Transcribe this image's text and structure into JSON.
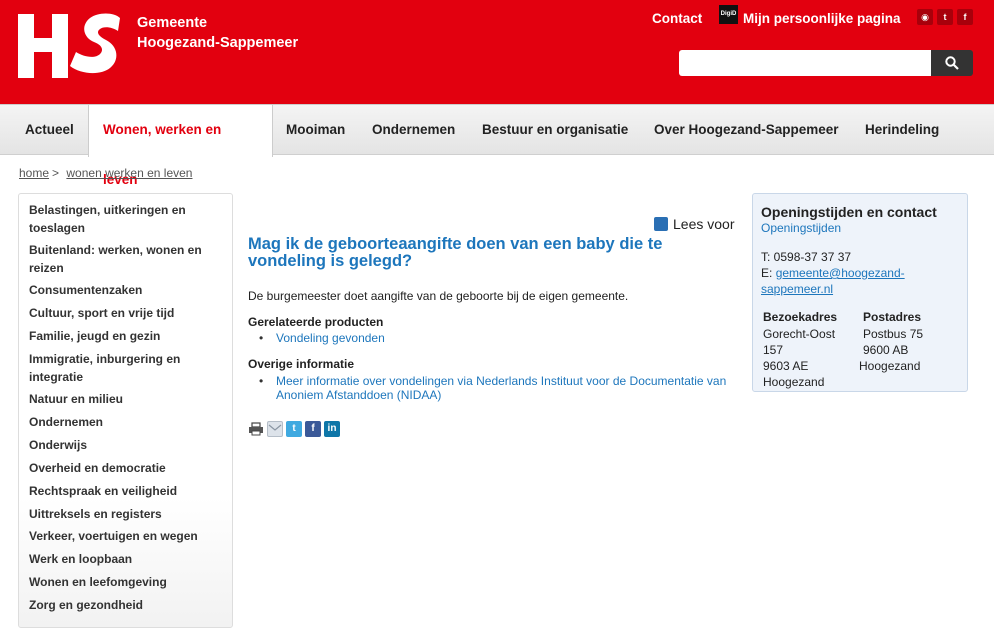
{
  "header": {
    "logo_text": "HS",
    "brand_line1": "Gemeente",
    "brand_line2": "Hoogezand-Sappemeer",
    "contact_label": "Contact",
    "digid_label": "DigiD",
    "my_page_label": "Mijn persoonlijke pagina",
    "search_placeholder": "",
    "colors": {
      "brand_red": "#e2000f",
      "link_blue": "#1d76bc"
    }
  },
  "nav": {
    "items": [
      {
        "label": "Actueel"
      },
      {
        "label": "Wonen, werken en leven"
      },
      {
        "label": "Mooiman"
      },
      {
        "label": "Ondernemen"
      },
      {
        "label": "Bestuur en organisatie"
      },
      {
        "label": "Over Hoogezand-Sappemeer"
      },
      {
        "label": "Herindeling"
      }
    ],
    "active": "Wonen, werken en leven"
  },
  "breadcrumb": {
    "home": "home",
    "separator": ">",
    "current": "wonen werken en leven"
  },
  "sidebar": {
    "items": [
      "Belastingen, uitkeringen en toeslagen",
      "Buitenland: werken, wonen en reizen",
      "Consumentenzaken",
      "Cultuur, sport en vrije tijd",
      "Familie, jeugd en gezin",
      "Immigratie, inburgering en integratie",
      "Natuur en milieu",
      "Ondernemen",
      "Onderwijs",
      "Overheid en democratie",
      "Rechtspraak en veiligheid",
      "Uittreksels en registers",
      "Verkeer, voertuigen en wegen",
      "Werk en loopbaan",
      "Wonen en leefomgeving",
      "Zorg en gezondheid"
    ]
  },
  "main": {
    "lees_voor": "Lees voor",
    "title": "Mag ik de geboorteaangifte doen van een baby die te vondeling is gelegd?",
    "lead": "De burgemeester doet aangifte van de geboorte bij de eigen gemeente.",
    "related_title": "Gerelateerde producten",
    "related_items": [
      "Vondeling gevonden"
    ],
    "other_title": "Overige informatie",
    "other_items": [
      "Meer informatie over vondelingen via Nederlands Instituut voor de Documentatie van Anoniem Afstanddoen (NIDAA)"
    ]
  },
  "contact": {
    "title": "Openingstijden en contact",
    "hours_link": "Openingstijden",
    "phone": "T: 0598-37 37 37",
    "email_prefix": "E:",
    "email": "gemeente@hoogezand-sappemeer.nl",
    "visit_head": "Bezoekadres",
    "visit_line1": "Gorecht-Oost",
    "visit_line2": "157",
    "visit_line3": "9603 AE",
    "visit_line4": "Hoogezand",
    "post_head": "Postadres",
    "post_line1": "Postbus 75",
    "post_line2": "9600 AB",
    "post_line3": "Hoogezand"
  }
}
